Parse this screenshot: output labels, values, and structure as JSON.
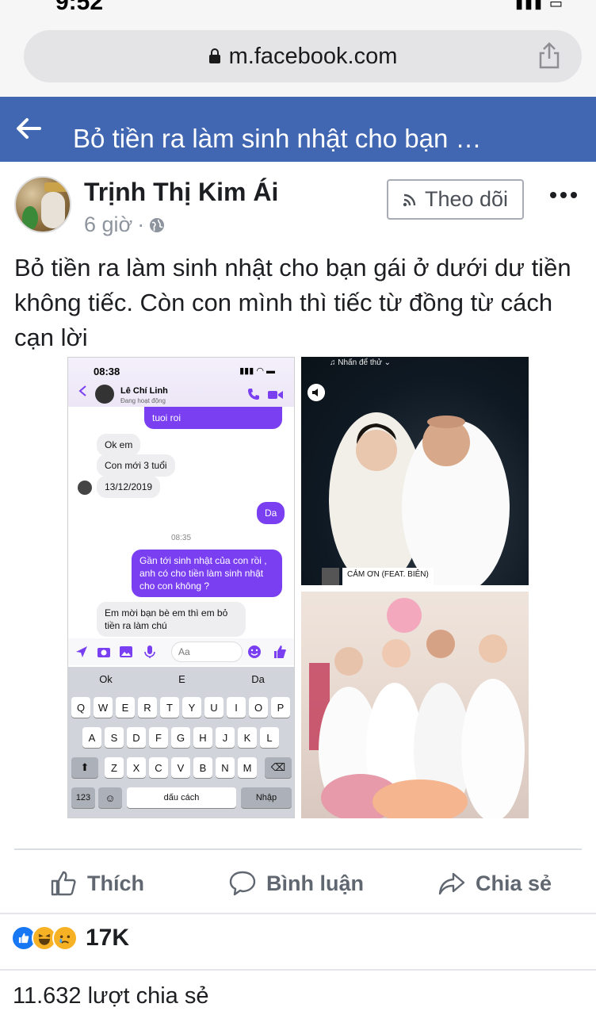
{
  "browser": {
    "status_time": "9:52",
    "url": "m.facebook.com"
  },
  "header": {
    "title": "Bỏ tiền ra làm sinh nhật cho bạn …"
  },
  "post": {
    "author": "Trịnh Thị Kim Ái",
    "time": "6 giờ",
    "separator": "·",
    "follow_label": "Theo dõi",
    "text": "Bỏ tiền ra làm sinh nhật cho bạn gái ở dưới dư tiền không tiếc. Còn con mình thì tiếc từ đồng từ cách cạn lời"
  },
  "screenshot": {
    "time": "08:38",
    "contact_name": "Lê Chí Linh",
    "contact_status": "Đang hoạt động",
    "msg_top": "tuoi roi",
    "msg_ok": "Ok em",
    "msg_age": "Con mới 3 tuổi",
    "msg_date": "13/12/2019",
    "msg_da": "Da",
    "stamp": "08:35",
    "msg_question": "Gần tới sinh nhật của con rồi , anh có cho tiền làm sinh nhật cho con không ?",
    "msg_reply": "Em mời bạn bè em thì em bỏ tiền ra làm chú",
    "input_placeholder": "Aa",
    "suggestions": [
      "Ok",
      "E",
      "Da"
    ],
    "row1": [
      "Q",
      "W",
      "E",
      "R",
      "T",
      "Y",
      "U",
      "I",
      "O",
      "P"
    ],
    "row2": [
      "A",
      "S",
      "D",
      "F",
      "G",
      "H",
      "J",
      "K",
      "L"
    ],
    "row3": [
      "Z",
      "X",
      "C",
      "V",
      "B",
      "N",
      "M"
    ],
    "key_123": "123",
    "key_space": "dấu cách",
    "key_return": "Nhập"
  },
  "photos": {
    "music_tag": "♫ Nhấn để thử ⌄",
    "song_label": "CẢM ƠN (FEAT. BIÊN)"
  },
  "actions": {
    "like": "Thích",
    "comment": "Bình luận",
    "share": "Chia sẻ"
  },
  "stats": {
    "reactions": "17K",
    "shares": "11.632 lượt chia sẻ"
  }
}
